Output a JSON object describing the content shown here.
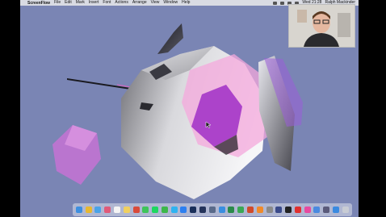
{
  "menubar": {
    "apple_glyph": "",
    "app_name": "ScreenFlow",
    "items": [
      "File",
      "Edit",
      "Mark",
      "Insert",
      "Font",
      "Actions",
      "Arrange",
      "View",
      "Window",
      "Help"
    ],
    "clock": "Wed 21:28",
    "user": "Ralph Mackinder"
  },
  "dock": {
    "icons": [
      {
        "name": "finder-icon",
        "color": "#3d8fe0"
      },
      {
        "name": "chrome-icon",
        "color": "#e8b830"
      },
      {
        "name": "safari-icon",
        "color": "#4aa3e8"
      },
      {
        "name": "photos-icon",
        "color": "#e05a7a"
      },
      {
        "name": "calendar-icon",
        "color": "#f4f4f4"
      },
      {
        "name": "notes-icon",
        "color": "#f0d060"
      },
      {
        "name": "chrome-2-icon",
        "color": "#d94a3a"
      },
      {
        "name": "whatsapp-icon",
        "color": "#3ec45a"
      },
      {
        "name": "spotify-icon",
        "color": "#1ed760"
      },
      {
        "name": "facetime-icon",
        "color": "#3cb84a"
      },
      {
        "name": "messages-icon",
        "color": "#2fb3f0"
      },
      {
        "name": "app-store-icon",
        "color": "#2d7ff0"
      },
      {
        "name": "photoshop-icon",
        "color": "#1a2f5a"
      },
      {
        "name": "lightroom-icon",
        "color": "#24335a"
      },
      {
        "name": "screenflow-icon",
        "color": "#5a6a8a"
      },
      {
        "name": "keynote-icon",
        "color": "#3a8ee0"
      },
      {
        "name": "excel-icon",
        "color": "#2a8a4a"
      },
      {
        "name": "numbers-icon",
        "color": "#3aa854"
      },
      {
        "name": "powerpoint-icon",
        "color": "#d04a2a"
      },
      {
        "name": "pages-icon",
        "color": "#f08a2a"
      },
      {
        "name": "settings-icon",
        "color": "#8a8a8a"
      },
      {
        "name": "bbedit-icon",
        "color": "#3a4a8a"
      },
      {
        "name": "terminal-icon",
        "color": "#222222"
      },
      {
        "name": "red-app-icon",
        "color": "#e03030"
      },
      {
        "name": "itunes-icon",
        "color": "#e84aa0"
      },
      {
        "name": "preview-icon",
        "color": "#4a8ae0"
      },
      {
        "name": "pyramid-app-icon",
        "color": "#5a5a7a"
      },
      {
        "name": "downloads-icon",
        "color": "#3a8ae0"
      },
      {
        "name": "trash-icon",
        "color": "#c8ccd4"
      }
    ]
  },
  "colors": {
    "desktop": "#7a85b4",
    "magenta": "#b04ad0",
    "pink": "#f0a0d8"
  }
}
